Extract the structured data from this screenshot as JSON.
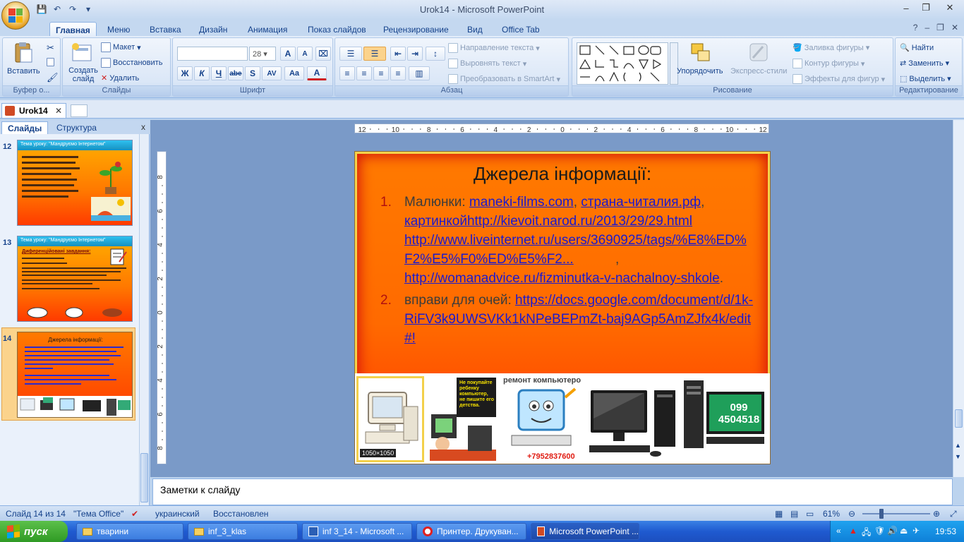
{
  "window": {
    "title": "Urok14 - Microsoft PowerPoint",
    "minimize": "–",
    "restore": "❐",
    "close": "✕"
  },
  "qat": {
    "save": "💾",
    "undo": "↶",
    "redo": "↷",
    "more": "▾"
  },
  "tabs": [
    "Главная",
    "Меню",
    "Вставка",
    "Дизайн",
    "Анимация",
    "Показ слайдов",
    "Рецензирование",
    "Вид",
    "Office Tab"
  ],
  "ribbon": {
    "clipboard": {
      "paste": "Вставить",
      "label": "Буфер о..."
    },
    "slides": {
      "new_slide": "Создать слайд",
      "layout": "Макет",
      "reset": "Восстановить",
      "delete": "Удалить",
      "label": "Слайды"
    },
    "font": {
      "size": "28",
      "label": "Шрифт",
      "bold": "Ж",
      "italic": "К",
      "underline": "Ч",
      "strike": "abe",
      "shadow": "S",
      "spacing": "AV",
      "case": "Aa",
      "color": "A",
      "grow": "A",
      "shrink": "A"
    },
    "paragraph": {
      "text_direction": "Направление текста",
      "align_text": "Выровнять текст",
      "smartart": "Преобразовать в SmartArt",
      "label": "Абзац"
    },
    "drawing": {
      "arrange": "Упорядочить",
      "quick_styles": "Экспресс-стили",
      "fill": "Заливка фигуры",
      "outline": "Контур фигуры",
      "effects": "Эффекты для фигур",
      "label": "Рисование"
    },
    "editing": {
      "find": "Найти",
      "replace": "Заменить",
      "select": "Выделить",
      "label": "Редактирование"
    }
  },
  "doc_tab": {
    "name": "Urok14",
    "close": "✕"
  },
  "panel": {
    "tab_slides": "Слайды",
    "tab_outline": "Структура",
    "close": "x"
  },
  "thumbnails": [
    {
      "num": "12",
      "title": "Тема уроку: \"Мандруємо Інтернетом\""
    },
    {
      "num": "13",
      "title": "Тема уроку: \"Мандруємо Інтернетом\"",
      "subtitle": "Диференційовані завдання:"
    },
    {
      "num": "14",
      "title": "Джерела інформації:"
    }
  ],
  "ruler": {
    "h_labels": [
      "12",
      "10",
      "8",
      "6",
      "4",
      "2",
      "0",
      "2",
      "4",
      "6",
      "8",
      "10",
      "12"
    ],
    "v_labels": [
      "8",
      "6",
      "4",
      "2",
      "0",
      "2",
      "4",
      "6",
      "8"
    ]
  },
  "slide": {
    "title": "Джерела інформації:",
    "items": [
      {
        "num": "1.",
        "lead": "Малюнки: ",
        "link1": "maneki-films.com",
        "sep1": ", ",
        "link2": "страна-читалия.рф",
        "sep2": ",",
        "link3": "картинкойhttp://kievoit.narod.ru/2013/29/29.html",
        "link4": "http://www.liveinternet.ru/users/3690925/tags/%E8%ED%F2%E5%F0%ED%E5%F2...",
        "sep4": ",",
        "link5": "http://womanadvice.ru/fizminutka-v-nachalnoy-shkole",
        "end": "."
      },
      {
        "num": "2.",
        "lead": "вправи для очей: ",
        "link1": "https://docs.google.com/document/d/1k-RiFV3k9UWSVKk1kNPeBEPmZt-baj9AGp5AmZJfx4k/edit#!"
      }
    ],
    "images": {
      "pic1_label": "1050×1050",
      "pic3_label": "ремонт компьютеро",
      "pic3_phone": "+7952837600",
      "pic2_sign": "Не покупайте ребенку компьютер, не пишите его детства.",
      "pic5_number1": "099",
      "pic5_number2": "4504518"
    }
  },
  "notes": {
    "placeholder": "Заметки к слайду"
  },
  "status": {
    "slide": "Слайд 14 из 14",
    "theme": "\"Тема Office\"",
    "language": "украинский",
    "state": "Восстановлен",
    "zoom": "61%"
  },
  "taskbar": {
    "start": "пуск",
    "items": [
      "тварини",
      "inf_3_klas",
      "inf 3_14 - Microsoft ...",
      "Принтер. Друкуван...",
      "Microsoft PowerPoint ..."
    ],
    "lang": "RU",
    "clock": "19:53"
  },
  "colors": {
    "accent": "#15428b",
    "slide_orange": "#ff6a00",
    "link": "#1a1ad0",
    "number_red": "#b01010",
    "taskbar_blue": "#1f5ad0",
    "start_green": "#2f9a24"
  }
}
